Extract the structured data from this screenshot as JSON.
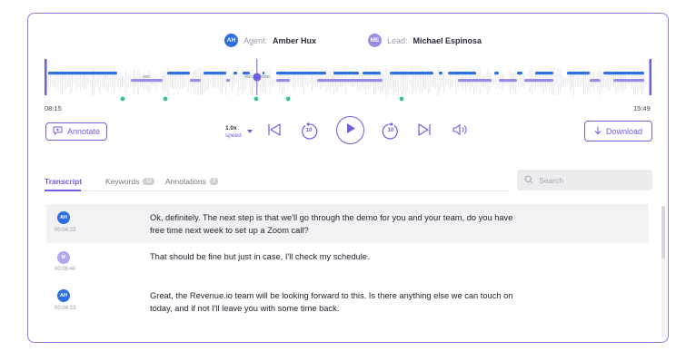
{
  "participants": {
    "agent": {
      "initials": "AH",
      "role_label": "Agent:",
      "name": "Amber Hux",
      "color": "#2f6fe0"
    },
    "lead": {
      "initials": "ME",
      "role_label": "Lead:",
      "name": "Michael Espinosa",
      "color": "#9a8ce6"
    }
  },
  "player": {
    "start_time": "08:15",
    "end_time": "15:49",
    "progress": 0.35,
    "annotate_label": "Annotate",
    "speed_value": "1.0x",
    "speed_label": "speed",
    "rewind_seconds": "10",
    "forward_seconds": "10",
    "download_label": "Download"
  },
  "tabs": [
    {
      "label": "Transcript",
      "badge": ""
    },
    {
      "label": "Keywords",
      "badge": "12"
    },
    {
      "label": "Annotations",
      "badge": "3"
    }
  ],
  "search": {
    "placeholder": "Search"
  },
  "transcript": [
    {
      "initials": "AH",
      "color": "#2f6fe0",
      "time": "00:04:23",
      "line1": "Ok, definitely. The next step is that we'll go through the demo for you and your team, do you have",
      "line2": "free time next week to set up a Zoom call?"
    },
    {
      "initials": "M",
      "color": "#b3a8ee",
      "time": "00:06:40",
      "line1": "That should be fine but just in case, I'll check my schedule.",
      "line2": ""
    },
    {
      "initials": "AH",
      "color": "#2f6fe0",
      "time": "00:04:23",
      "line1": "Great, the Revenue.io team will be looking forward to this. Is there anything else we can touch on",
      "line2": "today, and if not I'll leave you with some time back."
    }
  ],
  "colors": {
    "accent": "#6b5fe0",
    "agent_track": "#2f6fe0",
    "lead_track": "#9a8ce6",
    "marker": "#3fbf8a"
  }
}
